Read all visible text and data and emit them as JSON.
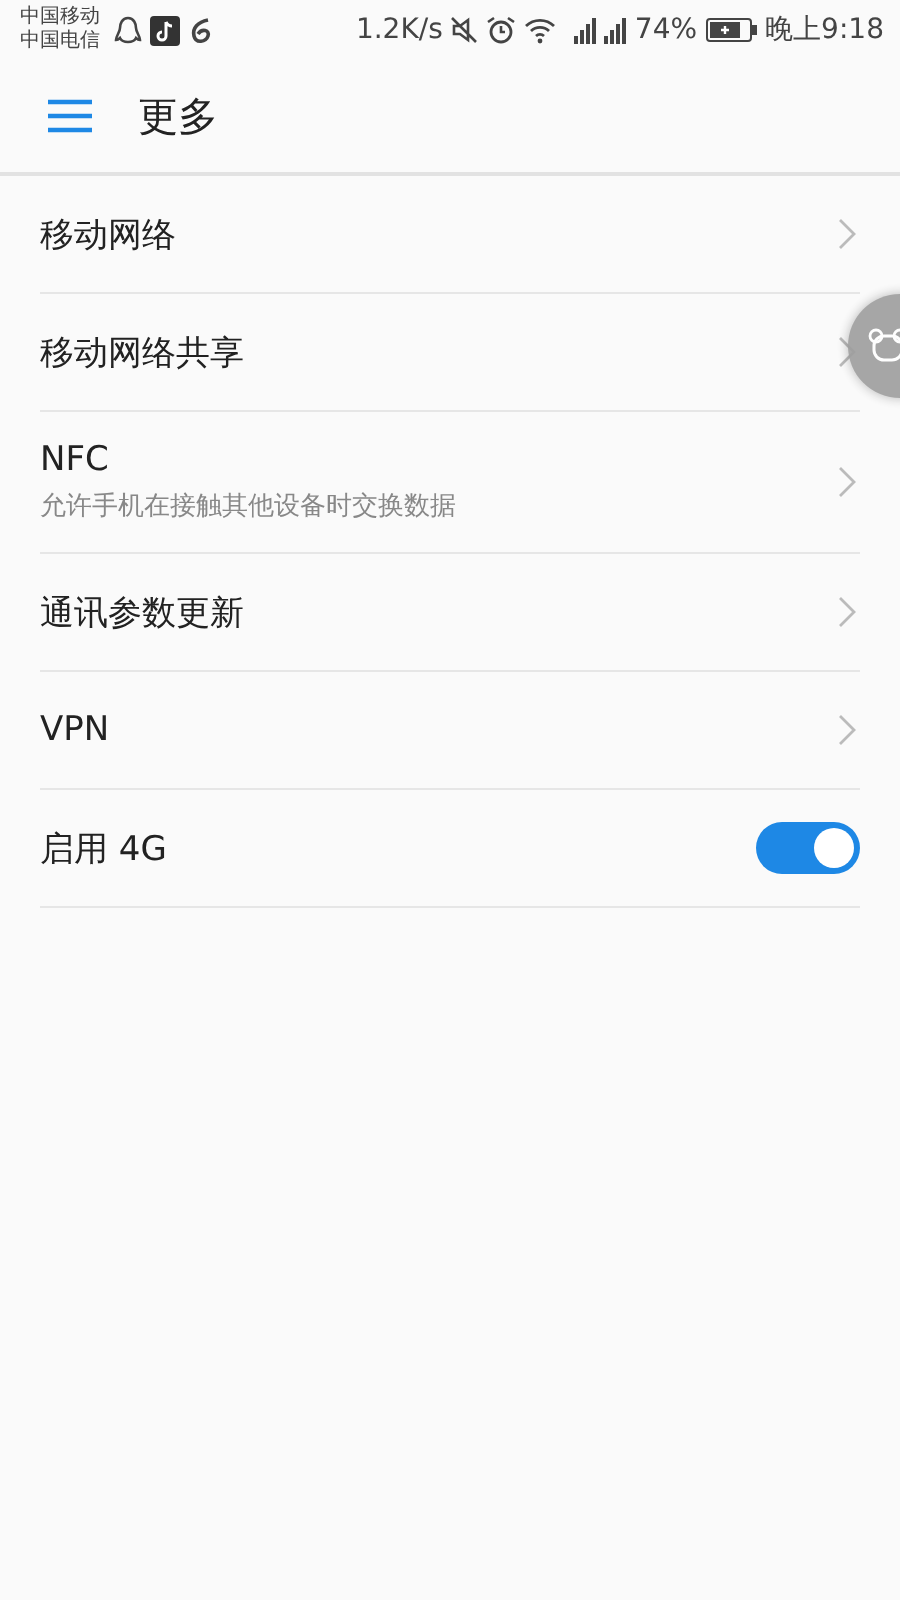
{
  "status_bar": {
    "carriers": [
      "中国移动",
      "中国电信"
    ],
    "speed": "1.2K/s",
    "battery": "74%",
    "time": "晚上9:18"
  },
  "header": {
    "title": "更多"
  },
  "items": [
    {
      "kind": "link",
      "title": "移动网络"
    },
    {
      "kind": "link",
      "title": "移动网络共享"
    },
    {
      "kind": "link",
      "title": "NFC",
      "subtitle": "允许手机在接触其他设备时交换数据"
    },
    {
      "kind": "link",
      "title": "通讯参数更新"
    },
    {
      "kind": "link",
      "title": "VPN"
    },
    {
      "kind": "toggle",
      "title": "启用 4G",
      "on": true
    }
  ]
}
